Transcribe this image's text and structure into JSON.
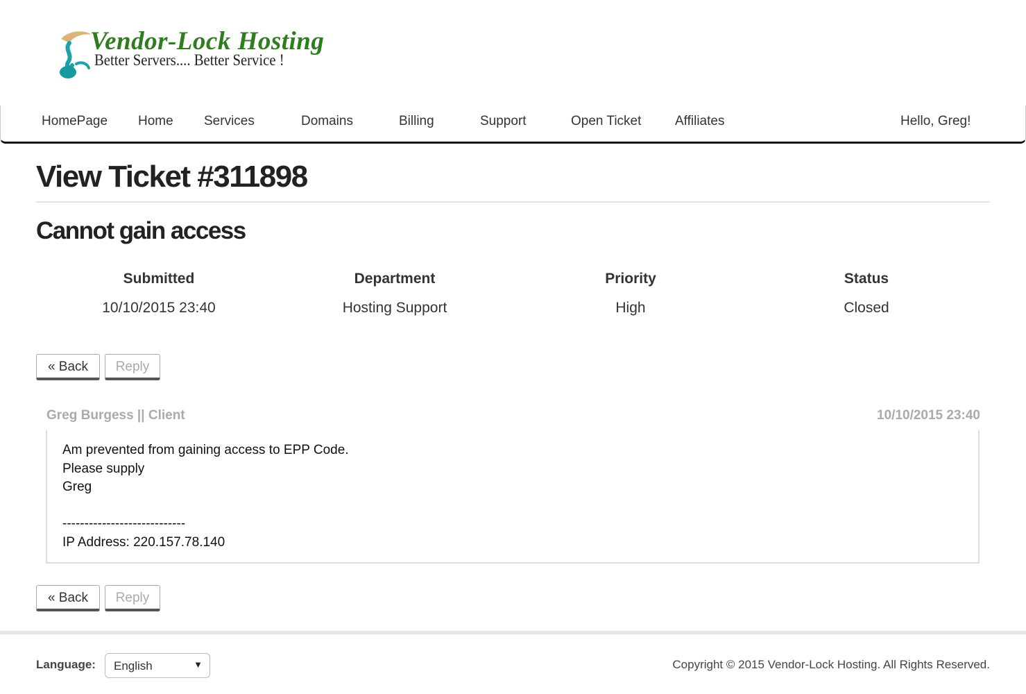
{
  "brand": {
    "name": "Vendor-Lock Hosting",
    "tagline": "Better Servers.... Better Service !"
  },
  "nav": {
    "items": [
      "HomePage",
      "Home",
      "Services",
      "Domains",
      "Billing",
      "Support",
      "Open Ticket",
      "Affiliates"
    ],
    "greeting": "Hello, Greg!"
  },
  "page": {
    "title": "View Ticket #311898",
    "subject": "Cannot gain access"
  },
  "ticket_meta": [
    {
      "label": "Submitted",
      "value": "10/10/2015 23:40"
    },
    {
      "label": "Department",
      "value": "Hosting Support"
    },
    {
      "label": "Priority",
      "value": "High"
    },
    {
      "label": "Status",
      "value": "Closed"
    }
  ],
  "actions": {
    "back": "« Back",
    "reply": "Reply"
  },
  "message": {
    "author": "Greg Burgess || Client",
    "date": "10/10/2015 23:40",
    "lines": [
      "Am prevented from gaining access to EPP Code.",
      "Please supply",
      "Greg",
      "",
      "----------------------------",
      "IP Address: 220.157.78.140"
    ]
  },
  "footer": {
    "language_label": "Language:",
    "language_selected": "English",
    "copyright": "Copyright © 2015 Vendor-Lock Hosting. All Rights Reserved."
  },
  "colors": {
    "logo_green": "#2e7d1e",
    "logo_teal": "#1aa3a8",
    "logo_tan": "#d9b57a",
    "muted": "#aaaaaa"
  },
  "icons": {
    "logo_mark": "drop-swirl-logo",
    "select_arrow": "triangle-down-icon"
  }
}
